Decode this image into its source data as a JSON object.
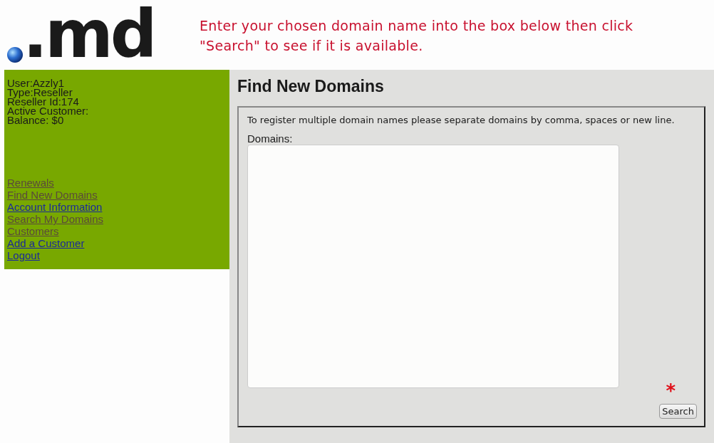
{
  "header": {
    "logo": ".md",
    "instruction": "Enter your chosen domain name into the box below then click \"Search\" to see if it is available."
  },
  "sidebar": {
    "info": [
      "User:Azzly1",
      "Type:Reseller",
      "Reseller Id:174",
      "Active Customer:",
      "Balance: $0"
    ],
    "links": [
      {
        "label": "Renewals",
        "visited": true
      },
      {
        "label": "Find New Domains",
        "visited": true
      },
      {
        "label": "Account Information",
        "visited": false
      },
      {
        "label": "Search My Domains",
        "visited": true
      },
      {
        "label": "Customers",
        "visited": true
      },
      {
        "label": "Add a Customer",
        "visited": false
      },
      {
        "label": "Logout",
        "visited": false
      }
    ]
  },
  "main": {
    "title": "Find New Domains",
    "note": "To register multiple domain names please separate domains by comma, spaces or new line.",
    "field_label": "Domains:",
    "required_mark": "*",
    "button": "Search"
  }
}
